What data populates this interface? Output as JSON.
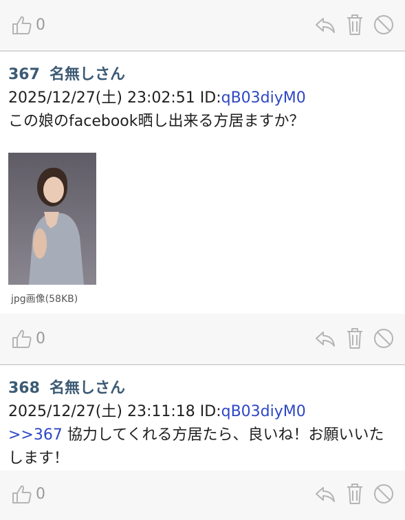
{
  "top_bar": {
    "like_count": "0"
  },
  "posts": [
    {
      "number": "367",
      "name": "名無しさん",
      "date": "2025/12/27(土) 23:02:51",
      "id_label": "ID:",
      "id_value": "qB03diyM0",
      "body": "この娘のfacebook晒し出来る方居ますか？",
      "attachment": {
        "caption": "jpg画像(58KB)"
      },
      "like_count": "0"
    },
    {
      "number": "368",
      "name": "名無しさん",
      "date": "2025/12/27(土) 23:11:18",
      "id_label": "ID:",
      "id_value": "qB03diyM0",
      "reply_anchor": ">>367",
      "body": " 協力してくれる方居たら、良いね！お願いいたします！",
      "like_count": "0"
    }
  ],
  "icons": {
    "like": "thumbs-up-icon",
    "reply": "reply-icon",
    "delete": "trash-icon",
    "block": "prohibited-icon"
  },
  "colors": {
    "header_text": "#3c5a74",
    "link": "#2d47c4",
    "icon": "#b4b4b4",
    "bar_bg": "#f7f7f7"
  }
}
